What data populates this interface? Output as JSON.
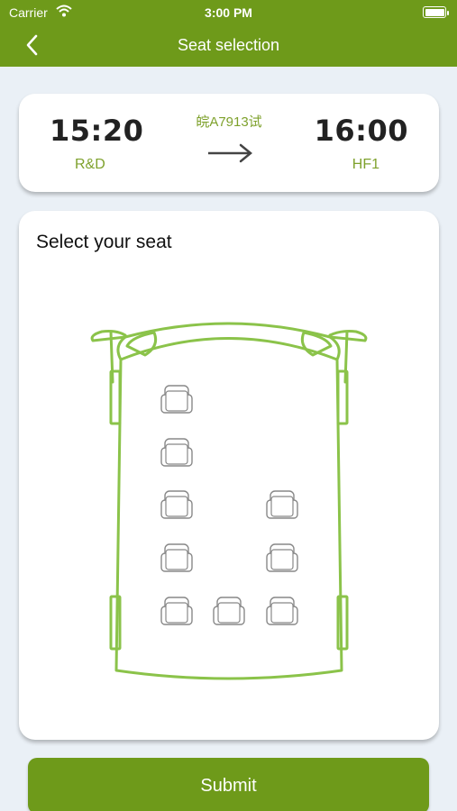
{
  "status_bar": {
    "carrier": "Carrier",
    "time": "3:00 PM"
  },
  "nav": {
    "title": "Seat selection",
    "back_icon": "chevron-left-icon"
  },
  "trip": {
    "departure_time": "15:20",
    "departure_stop": "R&D",
    "plate": "皖A7913试",
    "arrival_time": "16:00",
    "arrival_stop": "HF1"
  },
  "seat_map": {
    "heading": "Select your seat",
    "seats": [
      {
        "row": 1,
        "col": 1
      },
      {
        "row": 2,
        "col": 1
      },
      {
        "row": 3,
        "col": 1
      },
      {
        "row": 3,
        "col": 3
      },
      {
        "row": 4,
        "col": 1
      },
      {
        "row": 4,
        "col": 3
      },
      {
        "row": 5,
        "col": 1
      },
      {
        "row": 5,
        "col": 2
      },
      {
        "row": 5,
        "col": 3
      }
    ]
  },
  "submit_label": "Submit",
  "colors": {
    "brand": "#6e9a1a",
    "accent": "#7ea12c",
    "bus_outline": "#8bc34a",
    "seat_outline": "#888888"
  }
}
